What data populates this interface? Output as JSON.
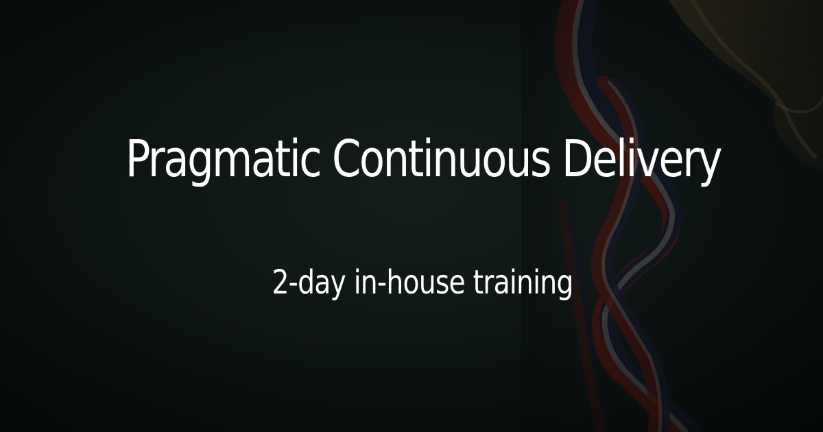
{
  "banner": {
    "title": "Pragmatic Continuous Delivery",
    "subtitle": "2-day in-house training",
    "background_image": "medal-ribbon-and-trophy",
    "colors": {
      "background": "#0c1312",
      "text": "#ffffff",
      "ribbon_red": "#6b1a16",
      "ribbon_navy": "#141a2c",
      "ribbon_white": "#8c8a86",
      "trophy_gold": "#6a5530"
    }
  }
}
